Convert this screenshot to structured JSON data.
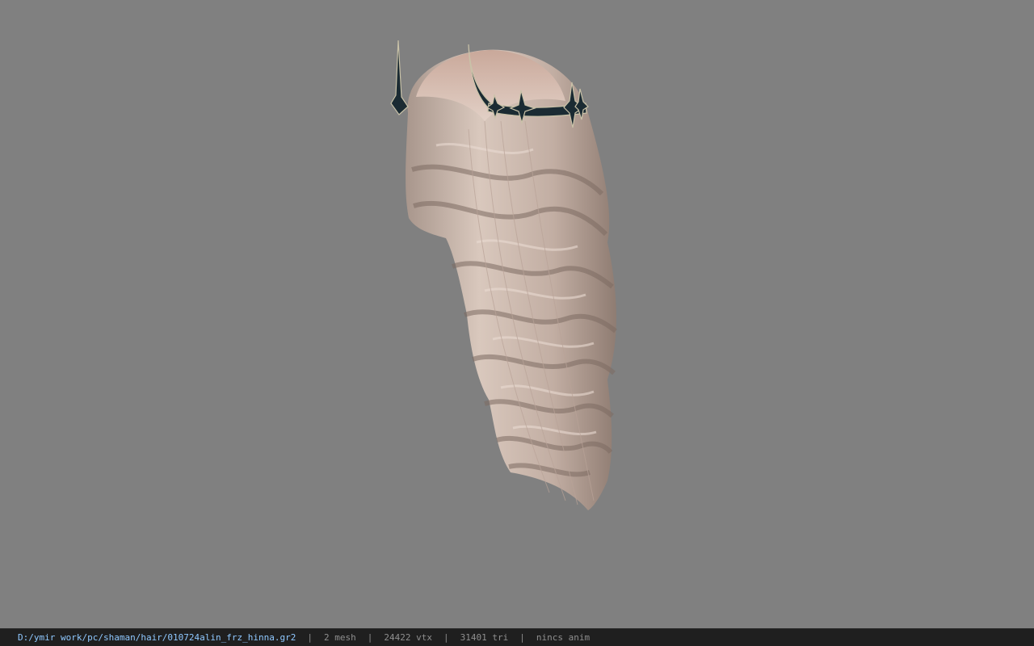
{
  "viewport": {
    "background": "#808080",
    "model": "hair mesh with dark spiked crown (3D preview)"
  },
  "statusbar": {
    "path": "D:/ymir work/pc/shaman/hair/010724alin_frz_hinna.gr2",
    "mesh": "2 mesh",
    "vtx": "24422 vtx",
    "tri": "31401 tri",
    "anim": "nincs anim",
    "separator": "|",
    "colors": {
      "path": "#8fc8ff",
      "text": "#8f8f8f",
      "background": "#1f1f1f"
    }
  }
}
